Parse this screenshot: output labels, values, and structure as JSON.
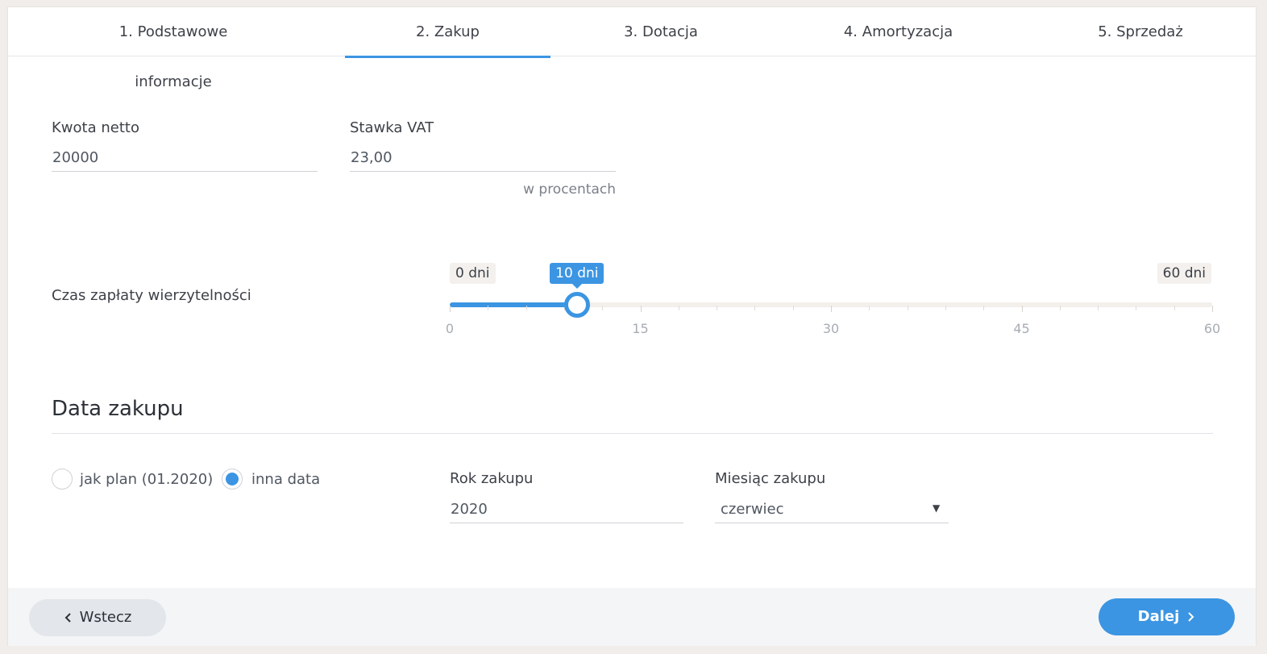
{
  "tabs": [
    {
      "label": "1. Podstawowe informacje"
    },
    {
      "label": "2. Zakup"
    },
    {
      "label": "3. Dotacja"
    },
    {
      "label": "4. Amortyzacja"
    },
    {
      "label": "5. Sprzedaż"
    }
  ],
  "active_tab": 1,
  "net_amount": {
    "label": "Kwota netto",
    "value": "20000"
  },
  "vat_rate": {
    "label": "Stawka VAT",
    "value": "23,00",
    "hint": "w procentach"
  },
  "payment_time": {
    "label": "Czas zapłaty wierzytelności",
    "min_label": "0 dni",
    "max_label": "60 dni",
    "current_label": "10 dni",
    "min": 0,
    "max": 60,
    "value": 10,
    "ticks": [
      "0",
      "15",
      "30",
      "45",
      "60"
    ]
  },
  "purchase_date": {
    "title": "Data zakupu",
    "options": [
      {
        "label": "jak plan (01.2020)",
        "checked": false
      },
      {
        "label": "inna data",
        "checked": true
      }
    ],
    "year": {
      "label": "Rok zakupu",
      "value": "2020"
    },
    "month": {
      "label": "Miesiąc zakupu",
      "value": "czerwiec",
      "arrow": "▼"
    }
  },
  "footer": {
    "back_label": "Wstecz",
    "next_label": "Dalej"
  },
  "colors": {
    "accent": "#3b95e2"
  }
}
